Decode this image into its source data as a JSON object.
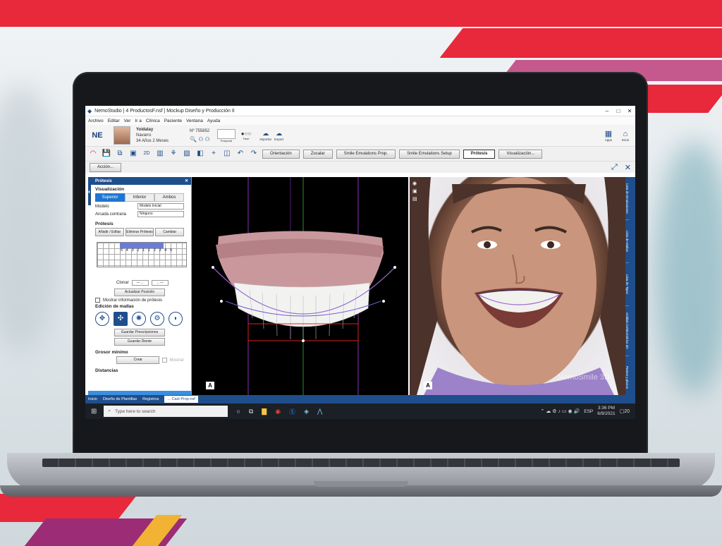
{
  "window": {
    "title": "NemoStudio  |  4 ProductosF.nsf | Mockup  Diseño y Producción II"
  },
  "menu": [
    "Archivo",
    "Editar",
    "Ver",
    "Ir a",
    "Clínica",
    "Paciente",
    "Ventana",
    "Ayuda"
  ],
  "patient": {
    "name_first": "Yoidalay",
    "name_last": "Navarro",
    "age": "34 Años 2 Meses",
    "number": "Nº 755852"
  },
  "topbar": {
    "temporal": "Temporal",
    "fase": "Fase",
    "importar": "Importar",
    "exportar": "Export",
    "apps": "Apps",
    "inicio": "Inicio",
    "logo": "NE"
  },
  "toolbar": {
    "buttons": [
      "Orientación",
      "Zocalar",
      "Smile Emulations Prop.",
      "Smile Emulations Setup",
      "Prótesis",
      "Visualización..."
    ]
  },
  "action_label": "Acción...",
  "panel": {
    "title": "Prótesis",
    "visualizacion": "Visualización",
    "seg": [
      "Superior",
      "Inferior",
      "Ambos"
    ],
    "modelo_lbl": "Modelo",
    "modelo_val": "Modelo Inicial",
    "arcada_lbl": "Arcada contraria",
    "arcada_val": "Ninguno",
    "protesis_sect": "Prótesis",
    "protesis_btns": [
      "Añadir / Editar",
      "Eliminar Prótesis",
      "Cambiar"
    ],
    "teeth_nums": "5 4 3 2 1 1 2 3 4 5",
    "clonar": "Clonar",
    "actualizar": "Actualizar Posición",
    "mostrar_info": "Mostrar información de prótesis",
    "edicion": "Edición de mallas",
    "guardar_presc": "Guardar Prescripciones",
    "guardar_diente": "Guardar Diente",
    "grosor": "Grosor mínimo",
    "crear": "Crear",
    "mostrar": "Mostrar",
    "distancias": "Distancias"
  },
  "right_strip": [
    "Lista de Emulaciones",
    "Lista de Mallas",
    "Lista de Tipos",
    "Análisis Cefalométrico 3D",
    "Puntos y planos"
  ],
  "view_badge": "A",
  "tabs": [
    "Inicio",
    "Diseño de Plantillas",
    "Registros",
    "... Cast Prop.nsf"
  ],
  "taskbar": {
    "search": "Type here to search",
    "time": "3:36 PM",
    "date": "6/9/2021",
    "lang": "ESP",
    "notif": "20"
  },
  "watermark": "NemoSmile 3D"
}
